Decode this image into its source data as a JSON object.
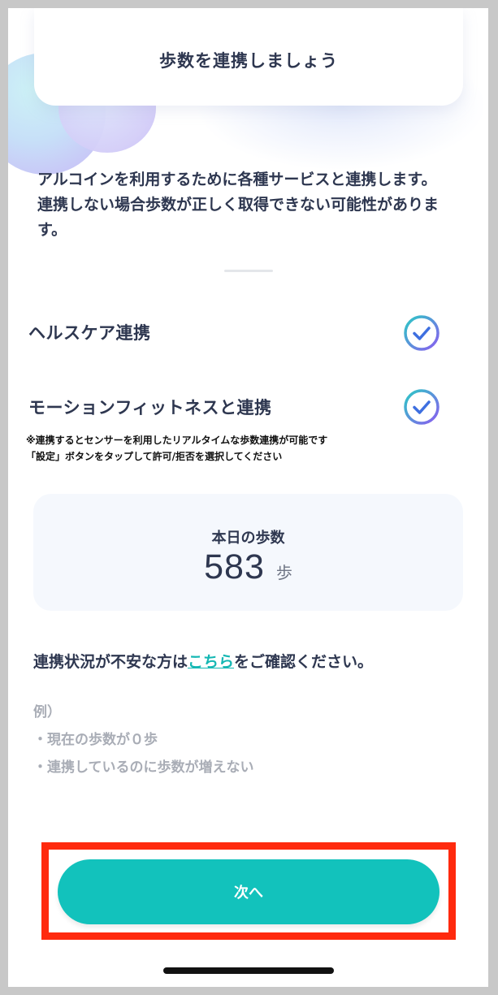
{
  "header": {
    "title": "歩数を連携しましょう"
  },
  "intro": {
    "line1": "アルコインを利用するために各種サービスと連携します。",
    "line2": "連携しない場合歩数が正しく取得できない可能性がありま",
    "line3": "す。"
  },
  "integrations": [
    {
      "label": "ヘルスケア連携",
      "checked": true
    },
    {
      "label": "モーションフィットネスと連携",
      "checked": true
    }
  ],
  "note": {
    "line1": "※連携するとセンサーを利用したリアルタイムな歩数連携が可能です",
    "line2": "「設定」ボタンをタップして許可/拒否を選択してください"
  },
  "steps": {
    "label": "本日の歩数",
    "value": "583",
    "unit": "歩"
  },
  "confirm": {
    "prefix": "連携状況が不安な方は",
    "link": "こちら",
    "suffix": "をご確認ください。"
  },
  "example": {
    "heading": "例）",
    "item1": "・現在の歩数が０歩",
    "item2": "・連携しているのに歩数が増えない"
  },
  "next_button": {
    "label": "次へ"
  },
  "colors": {
    "accent": "#12c2bc",
    "highlight_border": "#ff2a0e",
    "check_gradient_start": "#2bc9c5",
    "check_gradient_end": "#8a5cf0"
  }
}
